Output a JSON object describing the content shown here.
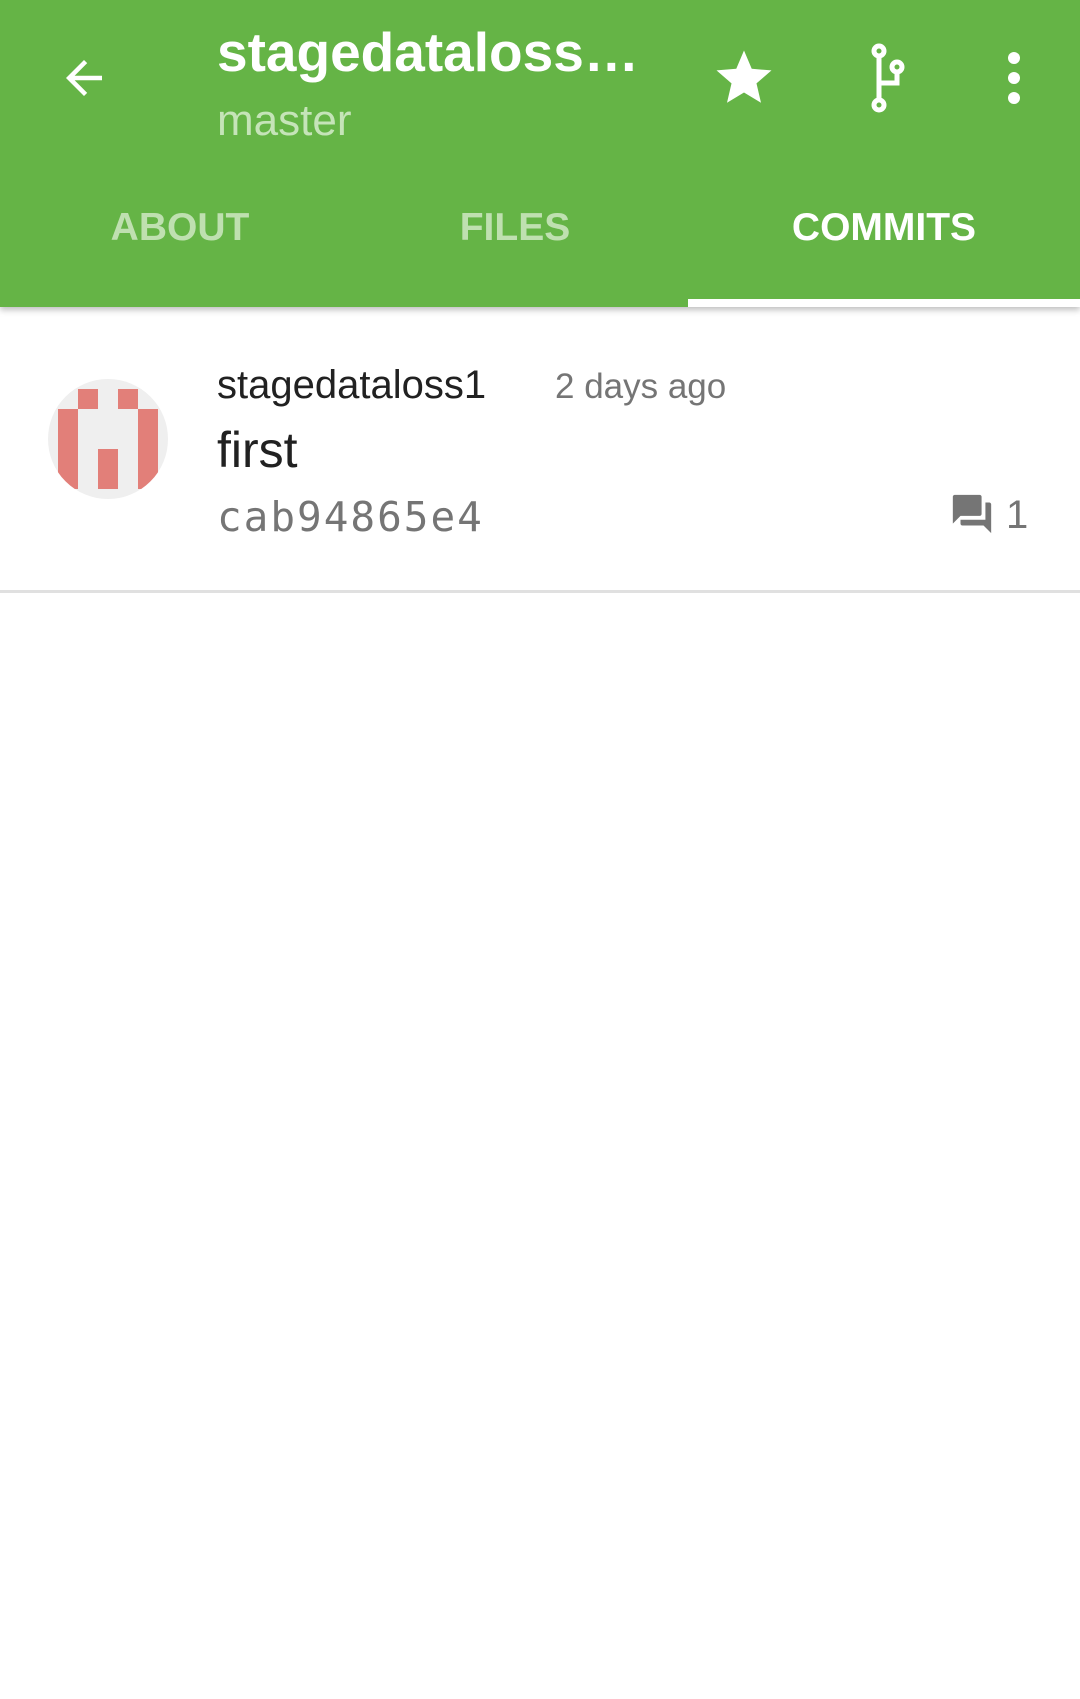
{
  "appbar": {
    "title": "stagedataloss…",
    "subtitle": "master",
    "icons": [
      "back-arrow-icon",
      "star-icon",
      "branch-icon",
      "more-vert-icon"
    ],
    "color": "#65b446"
  },
  "tabs": [
    {
      "label": "ABOUT",
      "active": false
    },
    {
      "label": "FILES",
      "active": false
    },
    {
      "label": "COMMITS",
      "active": true
    }
  ],
  "commits": [
    {
      "author": "stagedataloss1",
      "time": "2 days ago",
      "message": "first",
      "hash": "cab94865e4",
      "comments": "1"
    }
  ]
}
